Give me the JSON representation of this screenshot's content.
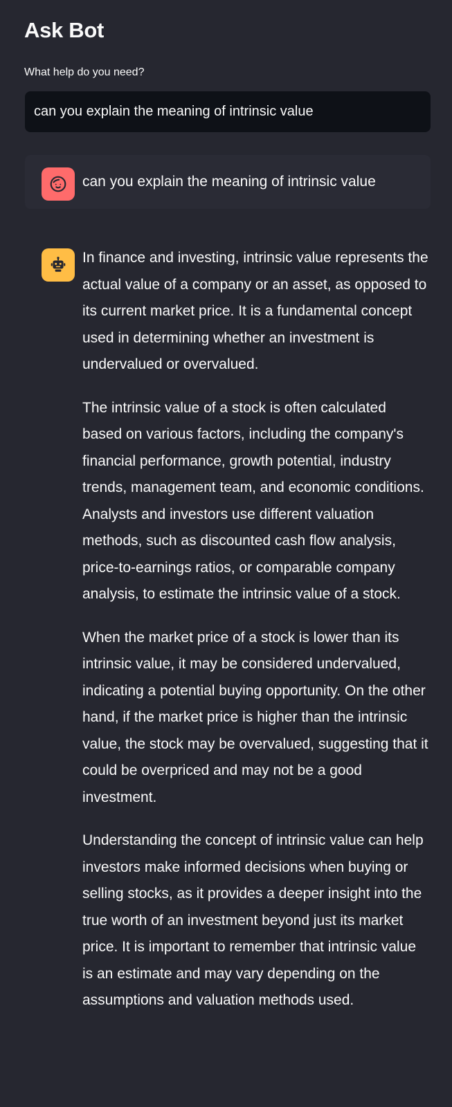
{
  "app": {
    "title": "Ask Bot"
  },
  "prompt": {
    "label": "What help do you need?",
    "value": "can you explain the meaning of intrinsic value"
  },
  "chat": {
    "user_message": {
      "avatar_icon": "user-face-icon",
      "avatar_color": "#ff6b6b",
      "text": "can you explain the meaning of intrinsic value"
    },
    "bot_message": {
      "avatar_icon": "robot-icon",
      "avatar_color": "#ffbd45",
      "paragraphs": [
        "In finance and investing, intrinsic value represents the actual value of a company or an asset, as opposed to its current market price. It is a fundamental concept used in determining whether an investment is undervalued or overvalued.",
        "The intrinsic value of a stock is often calculated based on various factors, including the company's financial performance, growth potential, industry trends, management team, and economic conditions. Analysts and investors use different valuation methods, such as discounted cash flow analysis, price-to-earnings ratios, or comparable company analysis, to estimate the intrinsic value of a stock.",
        "When the market price of a stock is lower than its intrinsic value, it may be considered undervalued, indicating a potential buying opportunity. On the other hand, if the market price is higher than the intrinsic value, the stock may be overvalued, suggesting that it could be overpriced and may not be a good investment.",
        "Understanding the concept of intrinsic value can help investors make informed decisions when buying or selling stocks, as it provides a deeper insight into the true worth of an investment beyond just its market price. It is important to remember that intrinsic value is an estimate and may vary depending on the assumptions and valuation methods used."
      ]
    }
  },
  "colors": {
    "background": "#262730",
    "input_background": "#0e1117",
    "text": "#fafafa"
  }
}
